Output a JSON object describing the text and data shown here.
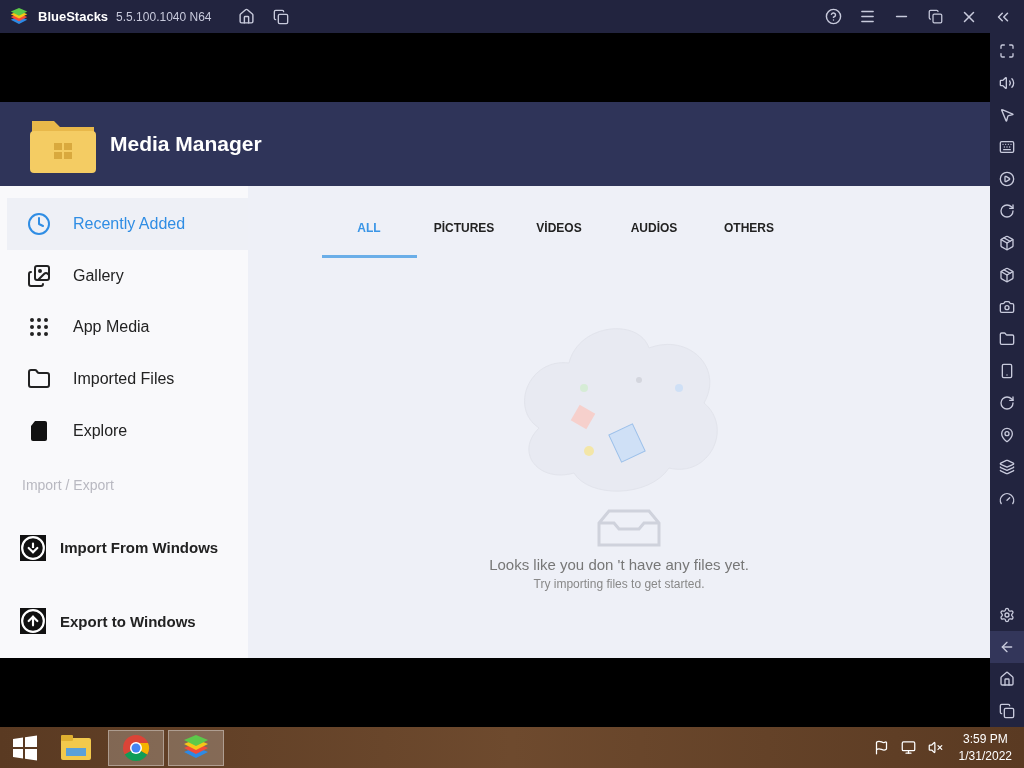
{
  "title_bar": {
    "app_name": "BlueStacks",
    "version": "5.5.100.1040 N64"
  },
  "app": {
    "title": "Media Manager"
  },
  "sidebar": {
    "items": [
      {
        "label": "Recently Added",
        "kind": "clock",
        "selected": true
      },
      {
        "label": "Gallery",
        "kind": "gallery",
        "selected": false
      },
      {
        "label": "App Media",
        "kind": "grid",
        "selected": false
      },
      {
        "label": "Imported Files",
        "kind": "folder",
        "selected": false
      },
      {
        "label": "Explore",
        "kind": "sdcard",
        "selected": false
      }
    ],
    "section_label": "Import / Export",
    "actions": [
      {
        "label": "Import From Windows",
        "kind": "import"
      },
      {
        "label": "Export to Windows",
        "kind": "export"
      }
    ]
  },
  "tabs": [
    {
      "label": "ALL",
      "selected": true
    },
    {
      "label": "PİCTURES",
      "selected": false
    },
    {
      "label": "VİDEOS",
      "selected": false
    },
    {
      "label": "AUDİOS",
      "selected": false
    },
    {
      "label": "OTHERS",
      "selected": false
    }
  ],
  "empty_state": {
    "message": "Looks like you don 't have any files yet.",
    "hint": "Try importing files to get started."
  },
  "taskbar": {
    "apps": [
      {
        "kind": "explorer",
        "running": false
      },
      {
        "kind": "chrome",
        "running": true
      },
      {
        "kind": "bluestacks",
        "running": true
      }
    ],
    "time": "3:59 PM",
    "date": "1/31/2022"
  }
}
